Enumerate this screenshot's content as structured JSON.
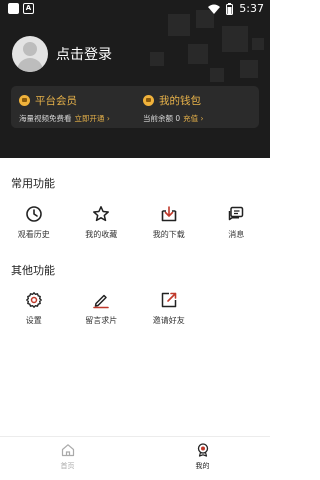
{
  "status_bar": {
    "time": "5:37"
  },
  "header": {
    "login_text": "点击登录",
    "vip": {
      "title": "平台会员",
      "subtitle": "海量视频免费看",
      "action": "立即开通 ›"
    },
    "wallet": {
      "title": "我的钱包",
      "subtitle": "当前余额 0",
      "action": "充值 ›"
    }
  },
  "common": {
    "title": "常用功能",
    "items": [
      {
        "label": "观看历史",
        "icon": "history-icon"
      },
      {
        "label": "我的收藏",
        "icon": "star-icon"
      },
      {
        "label": "我的下载",
        "icon": "download-icon"
      },
      {
        "label": "消息",
        "icon": "message-icon"
      }
    ]
  },
  "other": {
    "title": "其他功能",
    "items": [
      {
        "label": "设置",
        "icon": "settings-icon"
      },
      {
        "label": "留言求片",
        "icon": "edit-icon"
      },
      {
        "label": "邀请好友",
        "icon": "share-icon"
      }
    ]
  },
  "tabs": [
    {
      "label": "首页",
      "icon": "home-icon",
      "active": false
    },
    {
      "label": "我的",
      "icon": "profile-badge-icon",
      "active": true
    }
  ],
  "colors": {
    "accent": "#e7b24a",
    "header_bg": "#1c1c1c",
    "active_icon": "#c0392b"
  }
}
